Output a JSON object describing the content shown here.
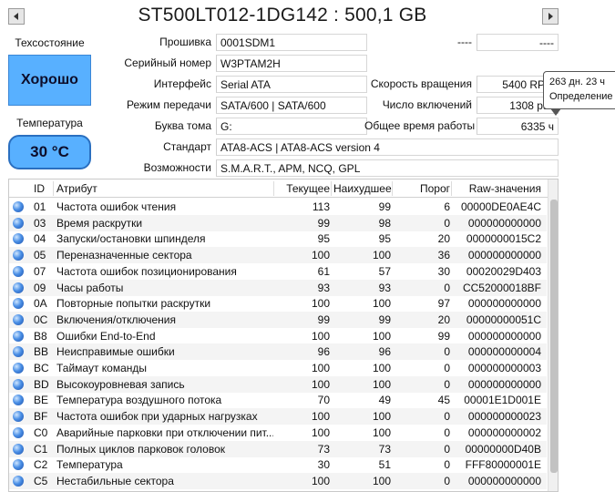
{
  "title": "ST500LT012-1DG142 : 500,1 GB",
  "nav": {
    "prev_icon": "triangle-left-icon",
    "next_icon": "triangle-right-icon"
  },
  "health": {
    "label": "Техсостояние",
    "value": "Хорошо",
    "color": "#58b0ff"
  },
  "temperature": {
    "label": "Температура",
    "value": "30 °C"
  },
  "info": {
    "firmware_label": "Прошивка",
    "firmware": "0001SDM1",
    "serial_label": "Серийный номер",
    "serial": "W3PTAM2H",
    "interface_label": "Интерфейс",
    "interface": "Serial ATA",
    "transfer_label": "Режим передачи",
    "transfer": "SATA/600 | SATA/600",
    "volume_label": "Буква тома",
    "volume": "G:",
    "standard_label": "Стандарт",
    "standard": "ATA8-ACS | ATA8-ACS version 4",
    "features_label": "Возможности",
    "features": "S.M.A.R.T., APM, NCQ, GPL",
    "right_top_1": "----",
    "right_top_1_val": "----",
    "rotation_label": "Скорость вращения",
    "rotation": "5400 RPM",
    "power_count_label": "Число включений",
    "power_count": "1308 раз",
    "power_time_label": "Общее время работы",
    "power_time": "6335 ч"
  },
  "tooltip": {
    "line1": "263 дн. 23 ч",
    "line2": "Определение"
  },
  "columns": {
    "id": "ID",
    "attr": "Атрибут",
    "current": "Текущее",
    "worst": "Наихудшее",
    "threshold": "Порог",
    "raw": "Raw-значения"
  },
  "rows": [
    {
      "id": "01",
      "name": "Частота ошибок чтения",
      "cur": "113",
      "worst": "99",
      "thr": "6",
      "raw": "00000DE0AE4C"
    },
    {
      "id": "03",
      "name": "Время раскрутки",
      "cur": "99",
      "worst": "98",
      "thr": "0",
      "raw": "000000000000"
    },
    {
      "id": "04",
      "name": "Запуски/остановки шпинделя",
      "cur": "95",
      "worst": "95",
      "thr": "20",
      "raw": "0000000015C2"
    },
    {
      "id": "05",
      "name": "Переназначенные сектора",
      "cur": "100",
      "worst": "100",
      "thr": "36",
      "raw": "000000000000"
    },
    {
      "id": "07",
      "name": "Частота ошибок позиционирования",
      "cur": "61",
      "worst": "57",
      "thr": "30",
      "raw": "00020029D403"
    },
    {
      "id": "09",
      "name": "Часы работы",
      "cur": "93",
      "worst": "93",
      "thr": "0",
      "raw": "CC52000018BF"
    },
    {
      "id": "0A",
      "name": "Повторные попытки раскрутки",
      "cur": "100",
      "worst": "100",
      "thr": "97",
      "raw": "000000000000"
    },
    {
      "id": "0C",
      "name": "Включения/отключения",
      "cur": "99",
      "worst": "99",
      "thr": "20",
      "raw": "00000000051C"
    },
    {
      "id": "B8",
      "name": "Ошибки End-to-End",
      "cur": "100",
      "worst": "100",
      "thr": "99",
      "raw": "000000000000"
    },
    {
      "id": "BB",
      "name": "Неисправимые ошибки",
      "cur": "96",
      "worst": "96",
      "thr": "0",
      "raw": "000000000004"
    },
    {
      "id": "BC",
      "name": "Таймаут команды",
      "cur": "100",
      "worst": "100",
      "thr": "0",
      "raw": "000000000003"
    },
    {
      "id": "BD",
      "name": "Высокоуровневая запись",
      "cur": "100",
      "worst": "100",
      "thr": "0",
      "raw": "000000000000"
    },
    {
      "id": "BE",
      "name": "Температура воздушного потока",
      "cur": "70",
      "worst": "49",
      "thr": "45",
      "raw": "00001E1D001E"
    },
    {
      "id": "BF",
      "name": "Частота ошибок при ударных нагрузках",
      "cur": "100",
      "worst": "100",
      "thr": "0",
      "raw": "000000000023"
    },
    {
      "id": "C0",
      "name": "Аварийные парковки при отключении пит...",
      "cur": "100",
      "worst": "100",
      "thr": "0",
      "raw": "000000000002"
    },
    {
      "id": "C1",
      "name": "Полных циклов парковок головок",
      "cur": "73",
      "worst": "73",
      "thr": "0",
      "raw": "00000000D40B"
    },
    {
      "id": "C2",
      "name": "Температура",
      "cur": "30",
      "worst": "51",
      "thr": "0",
      "raw": "FFF80000001E"
    },
    {
      "id": "C5",
      "name": "Нестабильные сектора",
      "cur": "100",
      "worst": "100",
      "thr": "0",
      "raw": "000000000000"
    }
  ]
}
